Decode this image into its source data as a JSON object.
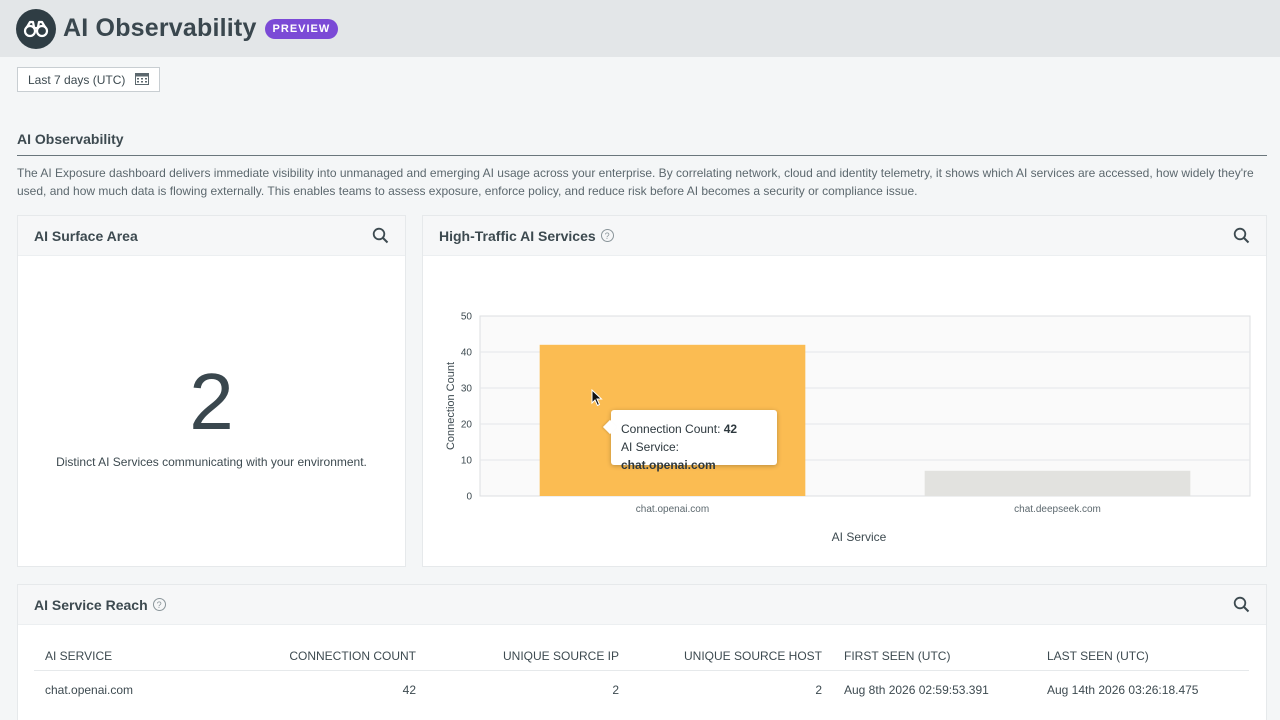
{
  "header": {
    "title": "AI Observability",
    "badge": "PREVIEW"
  },
  "filter": {
    "date_range": "Last 7 days (UTC)"
  },
  "section": {
    "title": "AI Observability",
    "description": "The AI Exposure dashboard delivers immediate visibility into unmanaged and emerging AI usage across your enterprise. By correlating network, cloud and identity telemetry, it shows which AI services are accessed, how widely they're used, and how much data is flowing externally. This enables teams to assess exposure, enforce policy, and reduce risk before AI becomes a security or compliance issue."
  },
  "surface_area": {
    "title": "AI Surface Area",
    "value": "2",
    "caption": "Distinct AI Services communicating with your environment."
  },
  "traffic": {
    "title": "High-Traffic AI Services",
    "tooltip": {
      "count_label": "Connection Count: ",
      "count_value": "42",
      "service_label": "AI Service: ",
      "service_value": "chat.openai.com"
    }
  },
  "chart_data": {
    "type": "bar",
    "categories": [
      "chat.openai.com",
      "chat.deepseek.com"
    ],
    "values": [
      42,
      7
    ],
    "xlabel": "AI Service",
    "ylabel": "Connection Count",
    "ylim": [
      0,
      50
    ],
    "yticks": [
      0,
      10,
      20,
      30,
      40,
      50
    ],
    "colors": [
      "#fbbc52",
      "#e2e2df"
    ],
    "grid": true
  },
  "reach": {
    "title": "AI Service Reach",
    "columns": [
      "AI SERVICE",
      "CONNECTION COUNT",
      "UNIQUE SOURCE IP",
      "UNIQUE SOURCE HOST",
      "FIRST SEEN (UTC)",
      "LAST SEEN (UTC)"
    ],
    "rows": [
      [
        "chat.openai.com",
        "42",
        "2",
        "2",
        "Aug 8th 2026 02:59:53.391",
        "Aug 14th 2026 03:26:18.475"
      ]
    ]
  }
}
